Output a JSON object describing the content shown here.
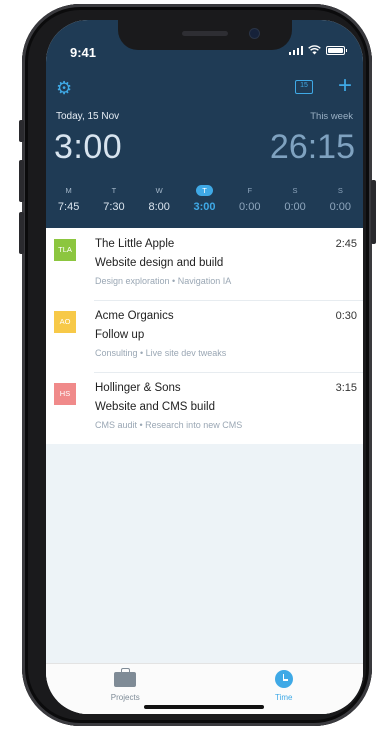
{
  "status": {
    "time": "9:41"
  },
  "header": {
    "today_label": "Today, 15 Nov",
    "this_week_label": "This week",
    "today_total": "3:00",
    "week_total": "26:15",
    "calendar_day": "15"
  },
  "week": [
    {
      "letter": "M",
      "value": "7:45"
    },
    {
      "letter": "T",
      "value": "7:30"
    },
    {
      "letter": "W",
      "value": "8:00"
    },
    {
      "letter": "T",
      "value": "3:00"
    },
    {
      "letter": "F",
      "value": "0:00"
    },
    {
      "letter": "S",
      "value": "0:00"
    },
    {
      "letter": "S",
      "value": "0:00"
    }
  ],
  "entries": [
    {
      "badge": "TLA",
      "badge_color": "#8cc63f",
      "client": "The Little Apple",
      "project": "Website design and build",
      "tasks": "Design exploration • Navigation IA",
      "duration": "2:45"
    },
    {
      "badge": "AO",
      "badge_color": "#f7c948",
      "client": "Acme Organics",
      "project": "Follow up",
      "tasks": "Consulting • Live site dev tweaks",
      "duration": "0:30"
    },
    {
      "badge": "HS",
      "badge_color": "#f08a8a",
      "client": "Hollinger & Sons",
      "project": "Website and CMS build",
      "tasks": "CMS audit • Research into new CMS",
      "duration": "3:15"
    }
  ],
  "tabs": [
    {
      "label": "Projects",
      "icon": "briefcase-icon"
    },
    {
      "label": "Time",
      "icon": "clock-icon"
    }
  ],
  "colors": {
    "accent": "#3fa9e6",
    "header_bg": "#1f3b55",
    "list_bg": "#edf3f7"
  }
}
